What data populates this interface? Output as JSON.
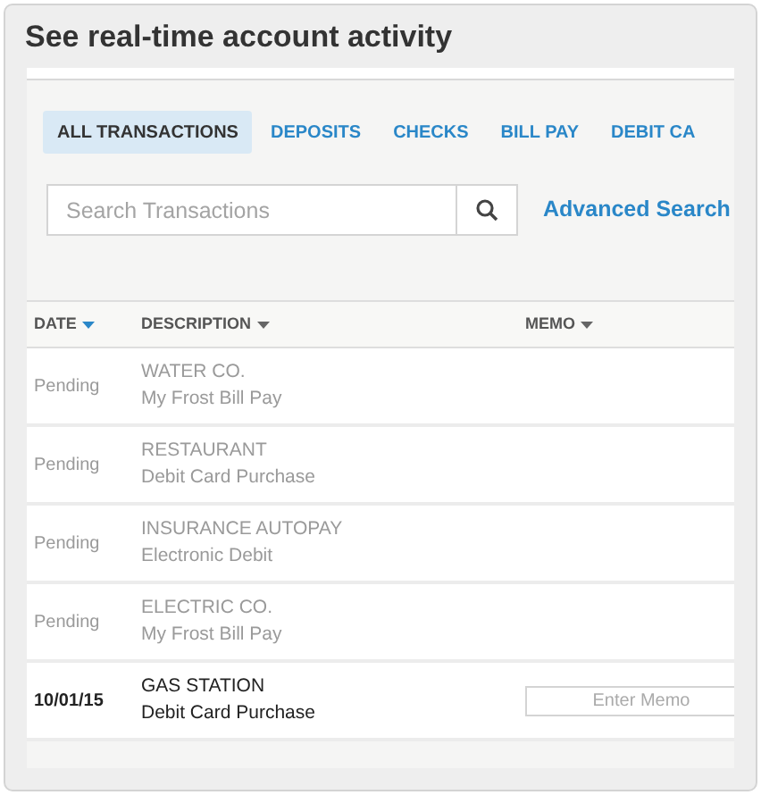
{
  "title": "See real-time account activity",
  "tabs": [
    {
      "label": "ALL TRANSACTIONS",
      "selected": true
    },
    {
      "label": "DEPOSITS",
      "selected": false
    },
    {
      "label": "CHECKS",
      "selected": false
    },
    {
      "label": "BILL PAY",
      "selected": false
    },
    {
      "label": "DEBIT CA",
      "selected": false
    }
  ],
  "search": {
    "placeholder": "Search Transactions"
  },
  "advanced_search": "Advanced Search",
  "table": {
    "columns": [
      {
        "label": "DATE",
        "sorted": true
      },
      {
        "label": "DESCRIPTION",
        "sorted": false
      },
      {
        "label": "MEMO",
        "sorted": false
      }
    ],
    "rows": [
      {
        "date": "Pending",
        "name": "WATER CO.",
        "type": "My Frost Bill Pay",
        "pending": true
      },
      {
        "date": "Pending",
        "name": "RESTAURANT",
        "type": "Debit Card Purchase",
        "pending": true
      },
      {
        "date": "Pending",
        "name": "INSURANCE AUTOPAY",
        "type": "Electronic Debit",
        "pending": true
      },
      {
        "date": "Pending",
        "name": "ELECTRIC CO.",
        "type": "My Frost Bill Pay",
        "pending": true
      },
      {
        "date": "10/01/15",
        "name": "GAS STATION",
        "type": "Debit Card Purchase",
        "pending": false,
        "memo_placeholder": "Enter Memo"
      }
    ]
  }
}
